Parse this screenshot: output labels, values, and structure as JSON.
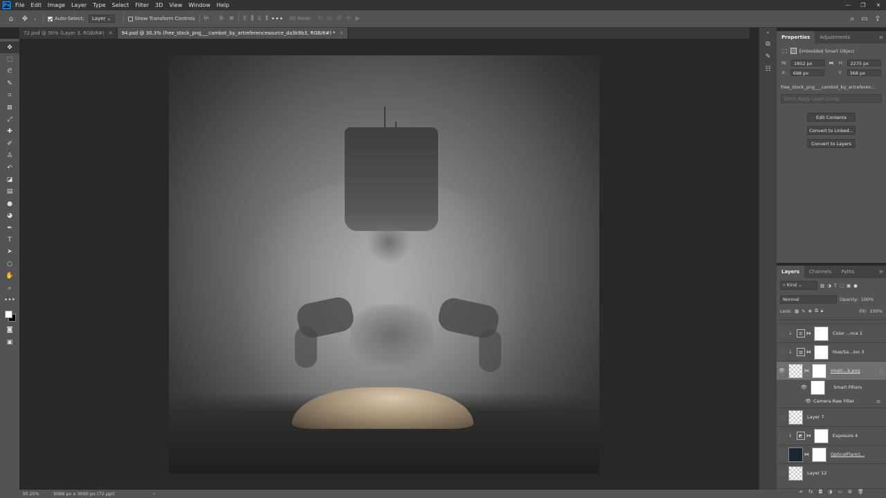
{
  "menubar": {
    "logo": "Ps",
    "items": [
      "File",
      "Edit",
      "Image",
      "Layer",
      "Type",
      "Select",
      "Filter",
      "3D",
      "View",
      "Window",
      "Help"
    ]
  },
  "options": {
    "auto_select_label": "Auto-Select:",
    "auto_select_target": "Layer",
    "show_transform_label": "Show Transform Controls",
    "mode_3d": "3D Mode:",
    "more": "•••"
  },
  "tabs": [
    {
      "label": "72.psd @ 50% (Layer 3, RGB/8#)",
      "active": false
    },
    {
      "label": "94.psd @ 30.3% (free_stock_png___cambot_by_artreferencesource_da3k9b3, RGB/8#) *",
      "active": true
    }
  ],
  "status": {
    "zoom": "30.25%",
    "doc_info": "3088 px x 3000 px (72 ppi)"
  },
  "properties": {
    "tab_properties": "Properties",
    "tab_adjustments": "Adjustments",
    "object_type": "Embedded Smart Object",
    "w_label": "W:",
    "w_value": "1852 px",
    "h_label": "H:",
    "h_value": "2275 px",
    "x_label": "X:",
    "x_value": "698 px",
    "y_label": "Y:",
    "y_value": "368 px",
    "filename": "free_stock_png___cambot_by_artreferen...",
    "layer_comp": "Don't Apply Layer Comp",
    "buttons": [
      "Edit Contents",
      "Convert to Linked...",
      "Convert to Layers"
    ]
  },
  "layers_panel": {
    "tabs": [
      "Layers",
      "Channels",
      "Paths"
    ],
    "filter_kind": "Kind",
    "blend_mode": "Normal",
    "opacity_label": "Opacity:",
    "opacity_value": "100%",
    "lock_label": "Lock:",
    "fill_label": "Fill:",
    "fill_value": "100%",
    "layers": [
      {
        "name": "Color ...nce 1",
        "kind": "adjustment",
        "visible": false
      },
      {
        "name": "Hue/Sa...ion 3",
        "kind": "adjustment",
        "visible": false
      },
      {
        "name": "imghi...k.png",
        "kind": "smart",
        "visible": true,
        "selected": true
      },
      {
        "name": "Layer 7",
        "kind": "pixel",
        "visible": false
      },
      {
        "name": "Exposure 4",
        "kind": "adjustment",
        "visible": false
      },
      {
        "name": "OpticalFlare1...",
        "kind": "smart-dark",
        "visible": false
      },
      {
        "name": "Layer 12",
        "kind": "pixel",
        "visible": false
      }
    ],
    "smart_filters": "Smart Filters",
    "camera_raw": "Camera Raw Filter"
  },
  "colors": {
    "app_bg": "#282828",
    "panel": "#535353",
    "accent_ps": "#31a8ff"
  }
}
